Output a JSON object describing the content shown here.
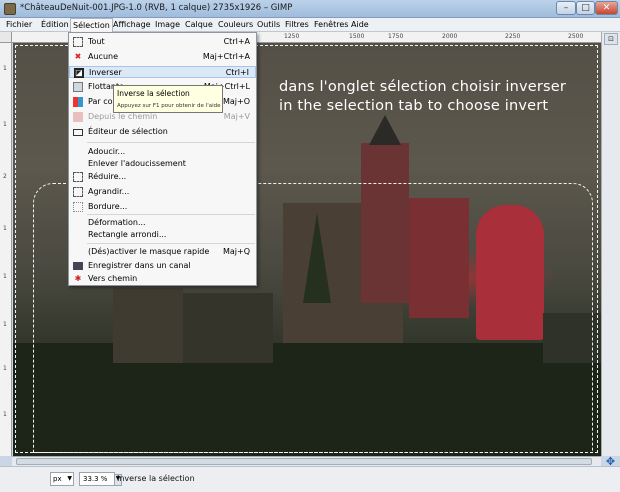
{
  "window": {
    "title": "*ChâteauDeNuit-001.JPG-1.0 (RVB, 1 calque) 2735x1926 – GIMP",
    "minimize": "–",
    "maximize": "□",
    "close": "✕"
  },
  "menubar": {
    "items": [
      "Fichier",
      "Édition",
      "Sélection",
      "Affichage",
      "Image",
      "Calque",
      "Couleurs",
      "Outils",
      "Filtres",
      "Fenêtres",
      "Aide"
    ]
  },
  "rulers": {
    "top_labels": [
      "1250",
      "1500",
      "1750",
      "2000",
      "2250",
      "2500"
    ],
    "left_labels": [
      "1",
      "1",
      "2",
      "1",
      "1",
      "1",
      "1",
      "1"
    ]
  },
  "selection_menu": {
    "items": [
      {
        "label": "Tout",
        "shortcut": "Ctrl+A",
        "icon": "select-all-icon",
        "disabled": false
      },
      {
        "label": "Aucune",
        "shortcut": "Maj+Ctrl+A",
        "icon": "select-none-icon",
        "disabled": false
      },
      {
        "label": "Inverser",
        "shortcut": "Ctrl+I",
        "icon": "invert-selection-icon",
        "disabled": false
      },
      {
        "label": "Flottante",
        "shortcut": "Maj+Ctrl+L",
        "icon": "float-icon",
        "disabled": false
      },
      {
        "label": "Par couleur",
        "shortcut": "Maj+O",
        "icon": "by-color-icon",
        "disabled": false
      },
      {
        "label": "Depuis le chemin",
        "shortcut": "Maj+V",
        "icon": "from-path-icon",
        "disabled": true
      },
      {
        "label": "Éditeur de sélection",
        "shortcut": "",
        "icon": "selection-editor-icon",
        "disabled": false
      },
      {
        "label": "Adoucir...",
        "shortcut": "",
        "icon": "",
        "disabled": false
      },
      {
        "label": "Enlever l'adoucissement",
        "shortcut": "",
        "icon": "",
        "disabled": false
      },
      {
        "label": "Réduire...",
        "shortcut": "",
        "icon": "shrink-icon",
        "disabled": false
      },
      {
        "label": "Agrandir...",
        "shortcut": "",
        "icon": "grow-icon",
        "disabled": false
      },
      {
        "label": "Bordure...",
        "shortcut": "",
        "icon": "border-icon",
        "disabled": false
      },
      {
        "label": "Déformation...",
        "shortcut": "",
        "icon": "",
        "disabled": false
      },
      {
        "label": "Rectangle arrondi...",
        "shortcut": "",
        "icon": "",
        "disabled": false
      },
      {
        "label": "(Dés)activer le masque rapide",
        "shortcut": "Maj+Q",
        "icon": "",
        "disabled": false
      },
      {
        "label": "Enregistrer dans un canal",
        "shortcut": "",
        "icon": "save-channel-icon",
        "disabled": false
      },
      {
        "label": "Vers chemin",
        "shortcut": "",
        "icon": "to-path-icon",
        "disabled": false
      }
    ]
  },
  "tooltip": {
    "title": "Inverse la sélection",
    "hint": "Appuyez sur F1 pour obtenir de l'aide"
  },
  "annotation": {
    "line1": "dans l'onglet sélection choisir inverser",
    "line2": "in the  selection  tab to choose invert"
  },
  "statusbar": {
    "units": "px",
    "zoom": "33.3 %",
    "message": "Inverse la sélection"
  },
  "colors": {
    "highlight": "#dbe8f6",
    "tooltip_bg": "#ffffe1",
    "annotation_text": "#ffffff"
  }
}
